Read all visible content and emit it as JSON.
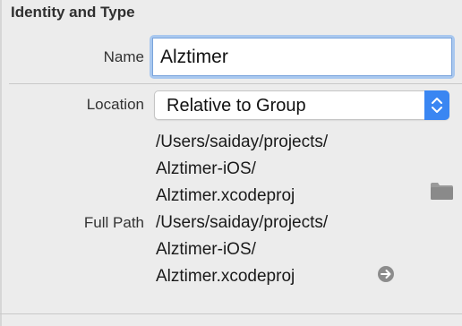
{
  "section": {
    "title": "Identity and Type"
  },
  "name": {
    "label": "Name",
    "value": "Alztimer"
  },
  "location": {
    "label": "Location",
    "selected": "Relative to Group",
    "path_lines": [
      "/Users/saiday/projects/",
      "Alztimer-iOS/",
      "Alztimer.xcodeproj"
    ],
    "reveal_icon": "folder-icon"
  },
  "full_path": {
    "label": "Full Path",
    "path_lines": [
      "/Users/saiday/projects/",
      "Alztimer-iOS/",
      "Alztimer.xcodeproj"
    ],
    "reveal_icon": "arrow-right-circle-icon"
  },
  "colors": {
    "accent": "#3a86f2",
    "focus_ring": "#a9c8ef",
    "panel_bg": "#ececec"
  }
}
